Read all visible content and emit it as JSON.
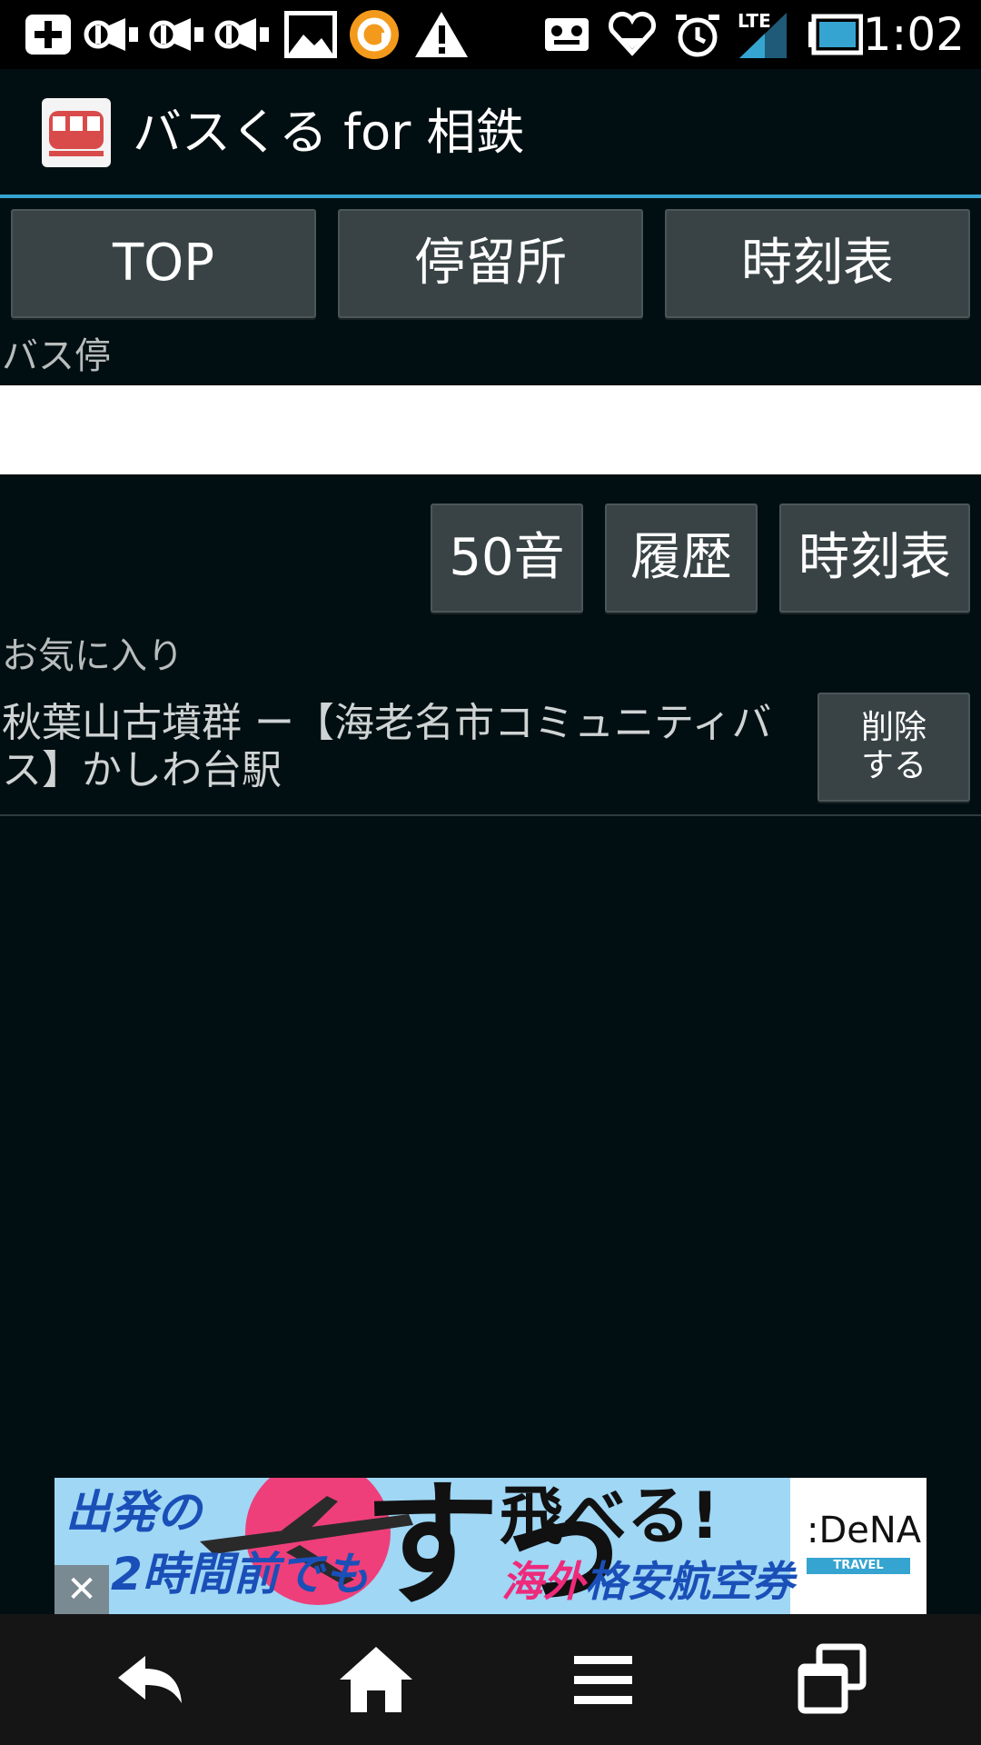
{
  "status_bar": {
    "time": "1:02",
    "network": "LTE",
    "icons": [
      "add-icon",
      "speaker-icon",
      "speaker-icon",
      "speaker-icon",
      "image-icon",
      "orange-app-icon",
      "warning-icon",
      "voicemail-icon",
      "heart-download-icon",
      "alarm-icon",
      "signal-icon",
      "battery-icon"
    ]
  },
  "app": {
    "title": "バスくる for 相鉄",
    "icon": "bus-icon",
    "accent_color": "#35a4d0"
  },
  "top_tabs": [
    {
      "label": "TOP"
    },
    {
      "label": "停留所"
    },
    {
      "label": "時刻表"
    }
  ],
  "bus_stop": {
    "label": "バス停",
    "value": ""
  },
  "search_buttons": [
    {
      "label": "50音"
    },
    {
      "label": "履歴"
    },
    {
      "label": "時刻表"
    }
  ],
  "favorites": {
    "label": "お気に入り",
    "items": [
      {
        "text": "秋葉山古墳群 ー【海老名市コミュニティバス】かしわ台駅",
        "delete_label": "削除\nする"
      }
    ]
  },
  "ad": {
    "line1": "出発の",
    "line2": "2時間前でも",
    "big_text": "すっ",
    "headline": "飛べる!",
    "sub_red": "海外",
    "sub_blue": "格安航空券",
    "brand": ":DeNA",
    "brand_sub": "TRAVEL",
    "close_label": "✕"
  },
  "nav_bar": {
    "buttons": [
      "back-icon",
      "home-icon",
      "menu-icon",
      "recent-apps-icon"
    ]
  }
}
